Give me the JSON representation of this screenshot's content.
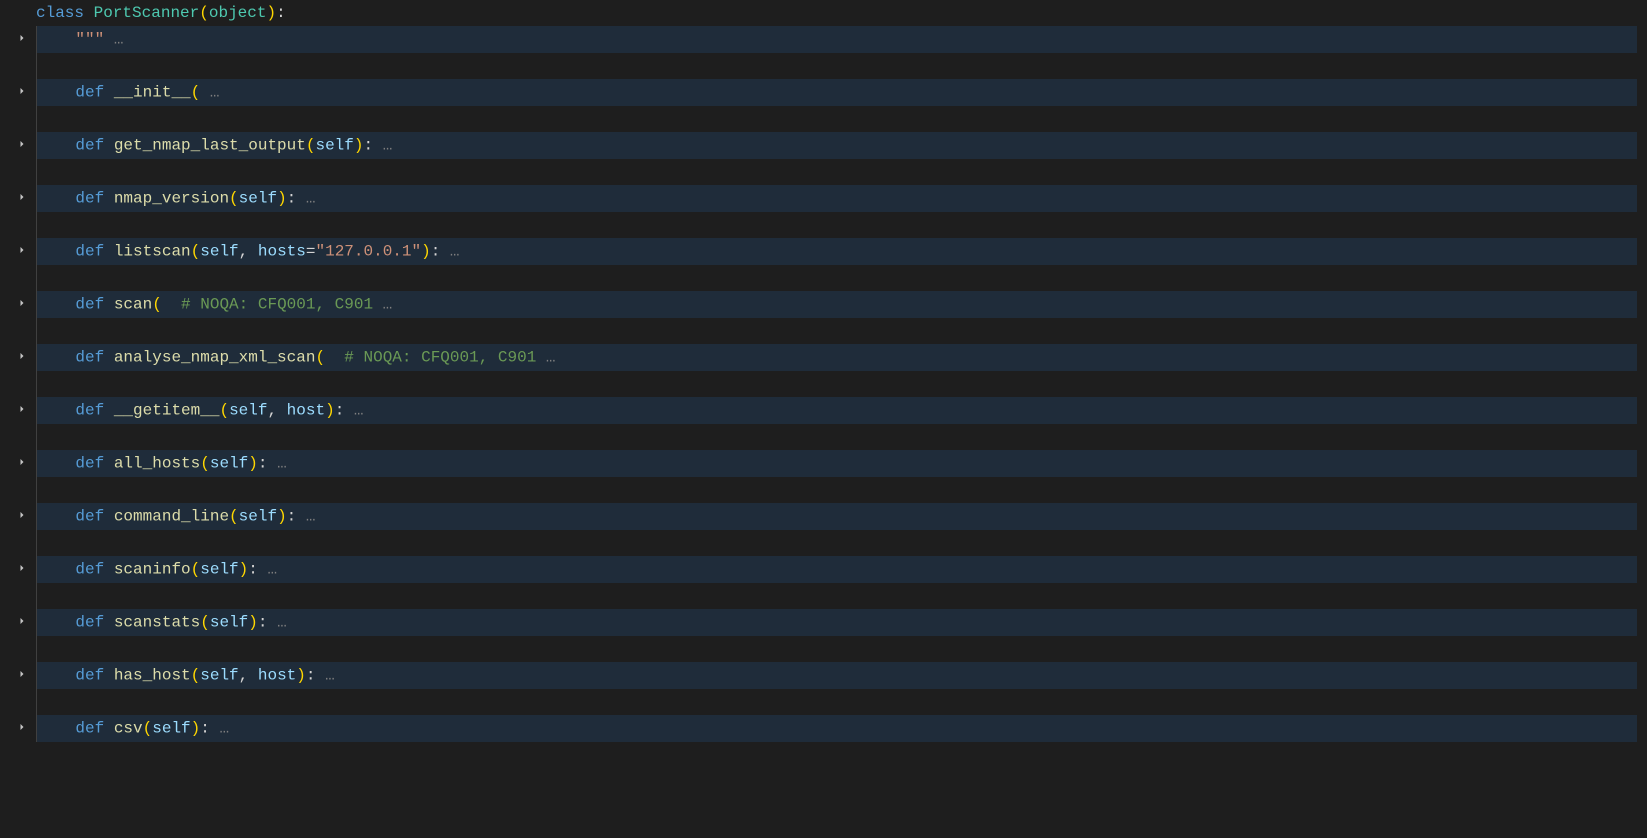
{
  "lines": [
    {
      "foldable": false,
      "highlight": false,
      "tokens": [
        {
          "t": "kw",
          "v": "class"
        },
        {
          "t": "punct",
          "v": " "
        },
        {
          "t": "cls",
          "v": "PortScanner"
        },
        {
          "t": "bracket-y",
          "v": "("
        },
        {
          "t": "builtin",
          "v": "object"
        },
        {
          "t": "bracket-y",
          "v": ")"
        },
        {
          "t": "punct",
          "v": ":"
        }
      ]
    },
    {
      "foldable": true,
      "highlight": true,
      "indent": 1,
      "tokens": [
        {
          "t": "str",
          "v": "\"\"\""
        },
        {
          "t": "fold-dots",
          "v": " …"
        }
      ]
    },
    {
      "foldable": false,
      "highlight": false,
      "indent": 1,
      "tokens": []
    },
    {
      "foldable": true,
      "highlight": true,
      "indent": 1,
      "tokens": [
        {
          "t": "kw",
          "v": "def"
        },
        {
          "t": "punct",
          "v": " "
        },
        {
          "t": "fn",
          "v": "__init__"
        },
        {
          "t": "bracket-y",
          "v": "("
        },
        {
          "t": "fold-dots",
          "v": " …"
        }
      ]
    },
    {
      "foldable": false,
      "highlight": false,
      "indent": 1,
      "tokens": []
    },
    {
      "foldable": true,
      "highlight": true,
      "indent": 1,
      "tokens": [
        {
          "t": "kw",
          "v": "def"
        },
        {
          "t": "punct",
          "v": " "
        },
        {
          "t": "fn",
          "v": "get_nmap_last_output"
        },
        {
          "t": "bracket-y",
          "v": "("
        },
        {
          "t": "param",
          "v": "self"
        },
        {
          "t": "bracket-y",
          "v": ")"
        },
        {
          "t": "punct",
          "v": ":"
        },
        {
          "t": "fold-dots",
          "v": " …"
        }
      ]
    },
    {
      "foldable": false,
      "highlight": false,
      "indent": 1,
      "tokens": []
    },
    {
      "foldable": true,
      "highlight": true,
      "indent": 1,
      "tokens": [
        {
          "t": "kw",
          "v": "def"
        },
        {
          "t": "punct",
          "v": " "
        },
        {
          "t": "fn",
          "v": "nmap_version"
        },
        {
          "t": "bracket-y",
          "v": "("
        },
        {
          "t": "param",
          "v": "self"
        },
        {
          "t": "bracket-y",
          "v": ")"
        },
        {
          "t": "punct",
          "v": ":"
        },
        {
          "t": "fold-dots",
          "v": " …"
        }
      ]
    },
    {
      "foldable": false,
      "highlight": false,
      "indent": 1,
      "tokens": []
    },
    {
      "foldable": true,
      "highlight": true,
      "indent": 1,
      "tokens": [
        {
          "t": "kw",
          "v": "def"
        },
        {
          "t": "punct",
          "v": " "
        },
        {
          "t": "fn",
          "v": "listscan"
        },
        {
          "t": "bracket-y",
          "v": "("
        },
        {
          "t": "param",
          "v": "self"
        },
        {
          "t": "punct",
          "v": ", "
        },
        {
          "t": "param",
          "v": "hosts"
        },
        {
          "t": "punct",
          "v": "="
        },
        {
          "t": "str",
          "v": "\"127.0.0.1\""
        },
        {
          "t": "bracket-y",
          "v": ")"
        },
        {
          "t": "punct",
          "v": ":"
        },
        {
          "t": "fold-dots",
          "v": " …"
        }
      ]
    },
    {
      "foldable": false,
      "highlight": false,
      "indent": 1,
      "tokens": []
    },
    {
      "foldable": true,
      "highlight": true,
      "indent": 1,
      "tokens": [
        {
          "t": "kw",
          "v": "def"
        },
        {
          "t": "punct",
          "v": " "
        },
        {
          "t": "fn",
          "v": "scan"
        },
        {
          "t": "bracket-y",
          "v": "("
        },
        {
          "t": "punct",
          "v": "  "
        },
        {
          "t": "comment",
          "v": "# NOQA: CFQ001, C901"
        },
        {
          "t": "fold-dots",
          "v": " …"
        }
      ]
    },
    {
      "foldable": false,
      "highlight": false,
      "indent": 1,
      "tokens": []
    },
    {
      "foldable": true,
      "highlight": true,
      "indent": 1,
      "tokens": [
        {
          "t": "kw",
          "v": "def"
        },
        {
          "t": "punct",
          "v": " "
        },
        {
          "t": "fn",
          "v": "analyse_nmap_xml_scan"
        },
        {
          "t": "bracket-y",
          "v": "("
        },
        {
          "t": "punct",
          "v": "  "
        },
        {
          "t": "comment",
          "v": "# NOQA: CFQ001, C901"
        },
        {
          "t": "fold-dots",
          "v": " …"
        }
      ]
    },
    {
      "foldable": false,
      "highlight": false,
      "indent": 1,
      "tokens": []
    },
    {
      "foldable": true,
      "highlight": true,
      "indent": 1,
      "tokens": [
        {
          "t": "kw",
          "v": "def"
        },
        {
          "t": "punct",
          "v": " "
        },
        {
          "t": "fn",
          "v": "__getitem__"
        },
        {
          "t": "bracket-y",
          "v": "("
        },
        {
          "t": "param",
          "v": "self"
        },
        {
          "t": "punct",
          "v": ", "
        },
        {
          "t": "param",
          "v": "host"
        },
        {
          "t": "bracket-y",
          "v": ")"
        },
        {
          "t": "punct",
          "v": ":"
        },
        {
          "t": "fold-dots",
          "v": " …"
        }
      ]
    },
    {
      "foldable": false,
      "highlight": false,
      "indent": 1,
      "tokens": []
    },
    {
      "foldable": true,
      "highlight": true,
      "indent": 1,
      "tokens": [
        {
          "t": "kw",
          "v": "def"
        },
        {
          "t": "punct",
          "v": " "
        },
        {
          "t": "fn",
          "v": "all_hosts"
        },
        {
          "t": "bracket-y",
          "v": "("
        },
        {
          "t": "param",
          "v": "self"
        },
        {
          "t": "bracket-y",
          "v": ")"
        },
        {
          "t": "punct",
          "v": ":"
        },
        {
          "t": "fold-dots",
          "v": " …"
        }
      ]
    },
    {
      "foldable": false,
      "highlight": false,
      "indent": 1,
      "tokens": []
    },
    {
      "foldable": true,
      "highlight": true,
      "indent": 1,
      "tokens": [
        {
          "t": "kw",
          "v": "def"
        },
        {
          "t": "punct",
          "v": " "
        },
        {
          "t": "fn",
          "v": "command_line"
        },
        {
          "t": "bracket-y",
          "v": "("
        },
        {
          "t": "param",
          "v": "self"
        },
        {
          "t": "bracket-y",
          "v": ")"
        },
        {
          "t": "punct",
          "v": ":"
        },
        {
          "t": "fold-dots",
          "v": " …"
        }
      ]
    },
    {
      "foldable": false,
      "highlight": false,
      "indent": 1,
      "tokens": []
    },
    {
      "foldable": true,
      "highlight": true,
      "indent": 1,
      "tokens": [
        {
          "t": "kw",
          "v": "def"
        },
        {
          "t": "punct",
          "v": " "
        },
        {
          "t": "fn",
          "v": "scaninfo"
        },
        {
          "t": "bracket-y",
          "v": "("
        },
        {
          "t": "param",
          "v": "self"
        },
        {
          "t": "bracket-y",
          "v": ")"
        },
        {
          "t": "punct",
          "v": ":"
        },
        {
          "t": "fold-dots",
          "v": " …"
        }
      ]
    },
    {
      "foldable": false,
      "highlight": false,
      "indent": 1,
      "tokens": []
    },
    {
      "foldable": true,
      "highlight": true,
      "indent": 1,
      "tokens": [
        {
          "t": "kw",
          "v": "def"
        },
        {
          "t": "punct",
          "v": " "
        },
        {
          "t": "fn",
          "v": "scanstats"
        },
        {
          "t": "bracket-y",
          "v": "("
        },
        {
          "t": "param",
          "v": "self"
        },
        {
          "t": "bracket-y",
          "v": ")"
        },
        {
          "t": "punct",
          "v": ":"
        },
        {
          "t": "fold-dots",
          "v": " …"
        }
      ]
    },
    {
      "foldable": false,
      "highlight": false,
      "indent": 1,
      "tokens": []
    },
    {
      "foldable": true,
      "highlight": true,
      "indent": 1,
      "tokens": [
        {
          "t": "kw",
          "v": "def"
        },
        {
          "t": "punct",
          "v": " "
        },
        {
          "t": "fn",
          "v": "has_host"
        },
        {
          "t": "bracket-y",
          "v": "("
        },
        {
          "t": "param",
          "v": "self"
        },
        {
          "t": "punct",
          "v": ", "
        },
        {
          "t": "param",
          "v": "host"
        },
        {
          "t": "bracket-y",
          "v": ")"
        },
        {
          "t": "punct",
          "v": ":"
        },
        {
          "t": "fold-dots",
          "v": " …"
        }
      ]
    },
    {
      "foldable": false,
      "highlight": false,
      "indent": 1,
      "tokens": []
    },
    {
      "foldable": true,
      "highlight": true,
      "indent": 1,
      "tokens": [
        {
          "t": "kw",
          "v": "def"
        },
        {
          "t": "punct",
          "v": " "
        },
        {
          "t": "fn",
          "v": "csv"
        },
        {
          "t": "bracket-y",
          "v": "("
        },
        {
          "t": "param",
          "v": "self"
        },
        {
          "t": "bracket-y",
          "v": ")"
        },
        {
          "t": "punct",
          "v": ":"
        },
        {
          "t": "fold-dots",
          "v": " …"
        }
      ]
    }
  ]
}
